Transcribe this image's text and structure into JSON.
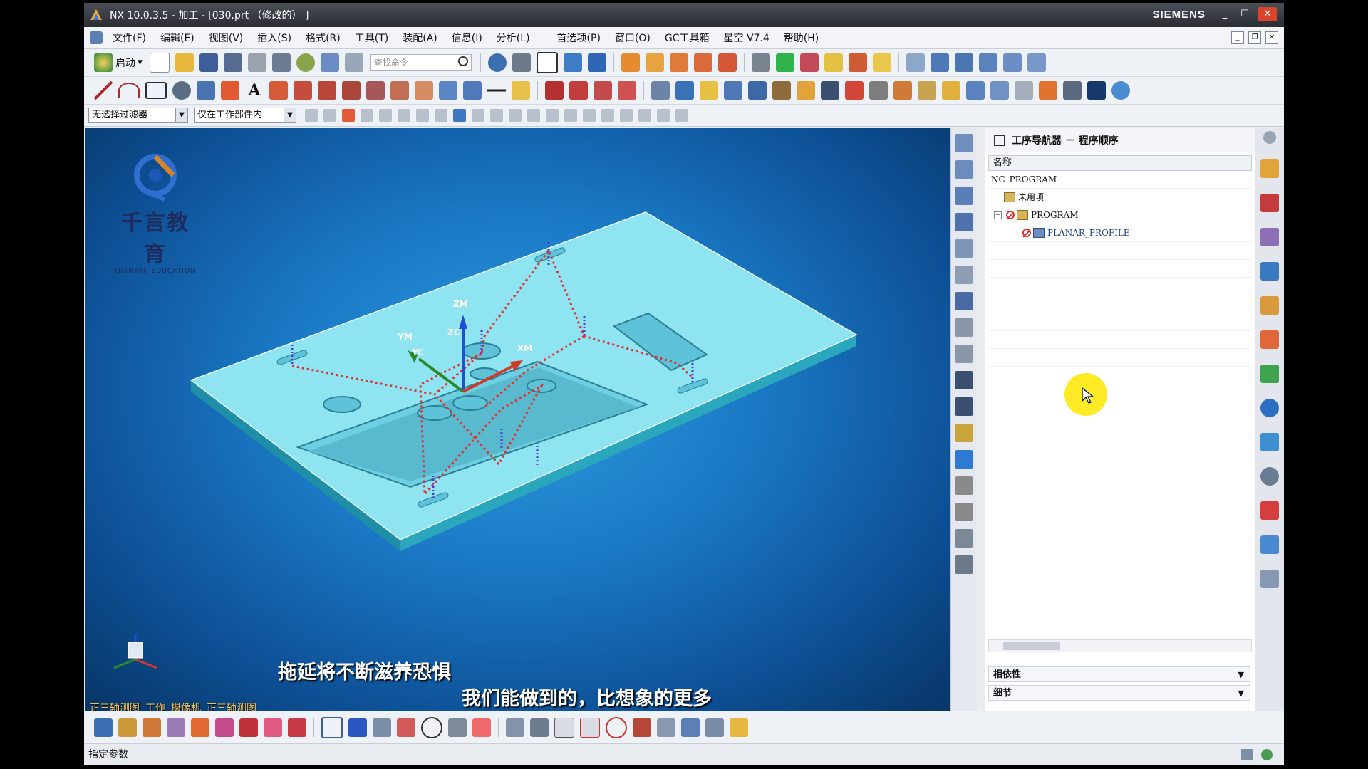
{
  "window": {
    "title": "NX 10.0.3.5 - 加工 - [030.prt （修改的） ]",
    "brand": "SIEMENS"
  },
  "menu": [
    "文件(F)",
    "编辑(E)",
    "视图(V)",
    "插入(S)",
    "格式(R)",
    "工具(T)",
    "装配(A)",
    "信息(I)",
    "分析(L)",
    "首选项(P)",
    "窗口(O)",
    "GC工具箱",
    "星空 V7.4",
    "帮助(H)"
  ],
  "toolbar": {
    "start_label": "启动",
    "search_placeholder": "查找命令"
  },
  "filterbar": {
    "selection_filter": "无选择过滤器",
    "scope": "仅在工作部件内"
  },
  "viewport": {
    "axes": [
      "ZM",
      "ZC",
      "YM",
      "YC",
      "XM"
    ],
    "logo_cn": "千言教育",
    "logo_en": "QIANYAN EDUCATION",
    "view_labels": [
      "正三轴测图",
      "工作",
      "摄像机",
      "正三轴测图"
    ],
    "subtitle_1": "拖延将不断滋养恐惧",
    "subtitle_2": "我们能做到的，比想象的更多",
    "colors": {
      "part": "#8fe4f2",
      "toolpath": "#e23030",
      "background": "#1a78c4"
    }
  },
  "navigator": {
    "title": "工序导航器 － 程序顺序",
    "column_name": "名称",
    "items": [
      {
        "label": "NC_PROGRAM",
        "level": 0
      },
      {
        "label": "未用项",
        "level": 1
      },
      {
        "label": "PROGRAM",
        "level": 1
      },
      {
        "label": "PLANAR_PROFILE",
        "level": 2
      }
    ],
    "dependency_label": "相依性",
    "details_label": "细节"
  },
  "status": {
    "prompt": "指定参数"
  }
}
